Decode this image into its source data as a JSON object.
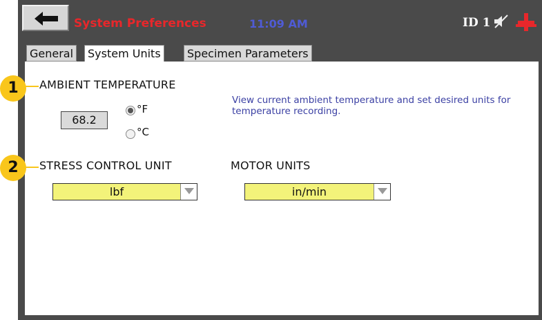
{
  "header": {
    "title": "System Preferences",
    "time": "11:09 AM",
    "id_label": "ID 1",
    "back_icon": "arrow-left-icon",
    "mute_icon": "speaker-muted-icon",
    "status_icon": "clamp-status-icon"
  },
  "tabs": [
    {
      "label": "General",
      "active": false
    },
    {
      "label": "System Units",
      "active": true
    },
    {
      "label": "Specimen Parameters",
      "active": false
    }
  ],
  "ambient": {
    "label": "AMBIENT TEMPERATURE",
    "value": "68.2",
    "hint": "View current ambient temperature and set desired units for temperature recording.",
    "options": [
      {
        "label": "°F",
        "checked": true
      },
      {
        "label": "°C",
        "checked": false
      }
    ]
  },
  "stress": {
    "label": "STRESS CONTROL UNIT",
    "selected": "lbf"
  },
  "motor": {
    "label": "MOTOR UNITS",
    "selected": "in/min"
  },
  "callouts": [
    "1",
    "2"
  ],
  "colors": {
    "title": "#e8272b",
    "time": "#4f5bd5",
    "hint": "#3a3fa3",
    "dropdown": "#f3f37a",
    "callout": "#f9c61b",
    "header_bg": "#4a4a4a"
  }
}
